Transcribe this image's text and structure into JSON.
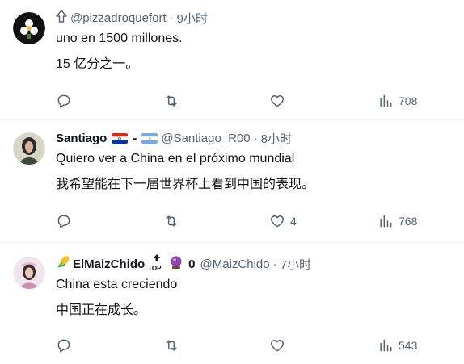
{
  "tweets": [
    {
      "prefix_icon": "arrow-up-outline-icon",
      "handle": "@pizzadroquefort",
      "dot": "·",
      "time": "9小时",
      "lines": [
        "uno en 1500 millones.",
        "15 亿分之一。"
      ],
      "actions": {
        "views": "708",
        "likes": ""
      }
    },
    {
      "name": "Santiago",
      "separator": "-",
      "handle": "@Santiago_R00",
      "dot": "·",
      "time": "8小时",
      "lines": [
        "Quiero ver a China en el próximo mundial",
        "我希望能在下一届世界杯上看到中国的表现。"
      ],
      "actions": {
        "views": "768",
        "likes": "4"
      }
    },
    {
      "name": "ElMaizChido",
      "top_label": "TOP",
      "suffix": "0",
      "handle": "@MaizChido",
      "dot": "·",
      "time": "7小时",
      "lines": [
        "China esta creciendo",
        "中国正在成长。"
      ],
      "actions": {
        "views": "543",
        "likes": ""
      }
    }
  ],
  "colors": {
    "text": "#0f1419",
    "secondary": "#536471",
    "divider": "#eff3f4"
  }
}
